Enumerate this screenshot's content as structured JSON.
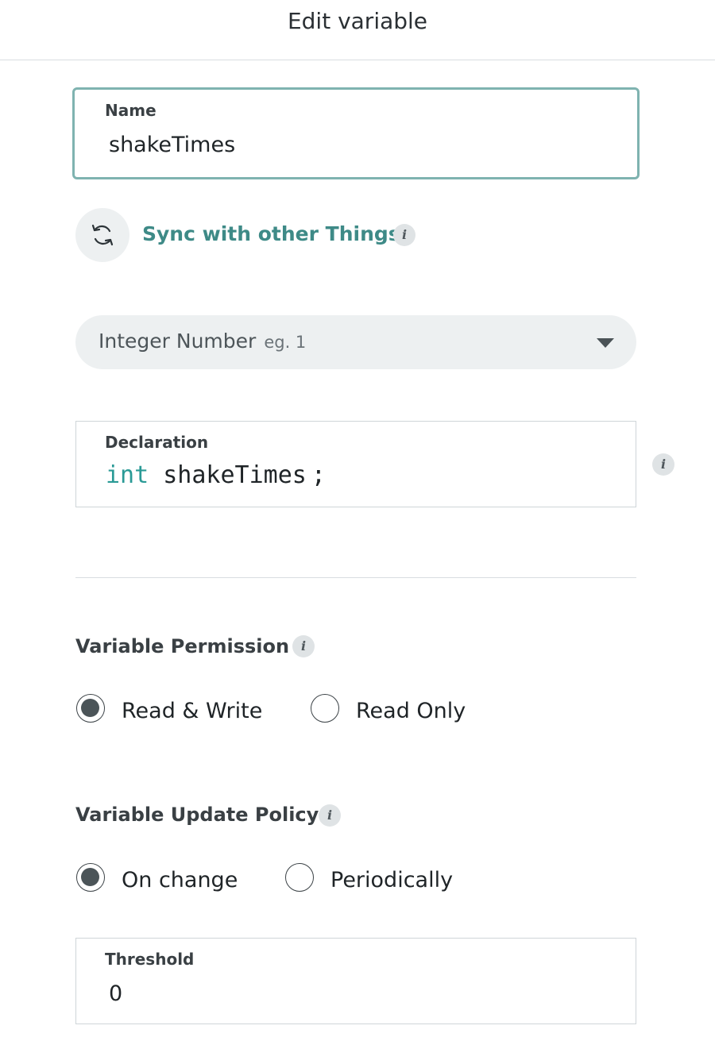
{
  "header": {
    "title": "Edit variable"
  },
  "name_field": {
    "label": "Name",
    "value": "shakeTimes"
  },
  "sync": {
    "label": "Sync with other Things"
  },
  "type_select": {
    "value": "Integer Number",
    "example": "eg. 1"
  },
  "declaration": {
    "label": "Declaration",
    "keyword": "int",
    "identifier": "shakeTimes",
    "terminator": ";"
  },
  "permission": {
    "title": "Variable Permission",
    "options": [
      {
        "label": "Read & Write",
        "selected": true
      },
      {
        "label": "Read Only",
        "selected": false
      }
    ]
  },
  "update_policy": {
    "title": "Variable Update Policy",
    "options": [
      {
        "label": "On change",
        "selected": true
      },
      {
        "label": "Periodically",
        "selected": false
      }
    ]
  },
  "threshold": {
    "label": "Threshold",
    "value": "0"
  },
  "icons": {
    "info": "i"
  },
  "colors": {
    "accent": "#3e8a87",
    "focus_border": "#7fb3b0",
    "keyword": "#2a9a96",
    "pill_bg": "#edf0f1"
  }
}
